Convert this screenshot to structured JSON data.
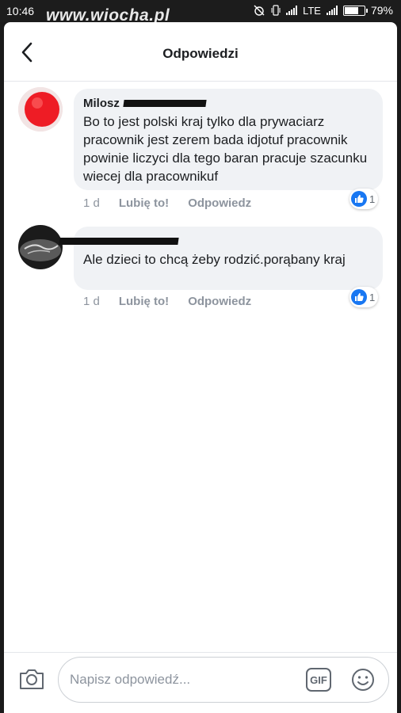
{
  "status_bar": {
    "time": "10:46",
    "watermark": "www.wiocha.pl",
    "network": "LTE",
    "battery": "79%",
    "battery_level": 0.79
  },
  "header": {
    "title": "Odpowiedzi",
    "back_icon": "chevron-left-icon"
  },
  "comments": [
    {
      "author": "Milosz",
      "text": "Bo to jest polski kraj tylko dla prywaciarz pracownik jest zerem bada idjotuf pracownik powinie liczyci dla tego baran pracuje szacunku wiecej dla pracownikuf",
      "time": "1 d",
      "like_label": "Lubię to!",
      "reply_label": "Odpowiedz",
      "reactions": "1"
    },
    {
      "author": "",
      "text": "Ale dzieci to chcą żeby rodzić.porąbany kraj",
      "time": "1 d",
      "like_label": "Lubię to!",
      "reply_label": "Odpowiedz",
      "reactions": "1"
    }
  ],
  "composer": {
    "placeholder": "Napisz odpowiedź...",
    "gif_label": "GIF",
    "camera_icon": "camera-icon",
    "emoji_icon": "smiley-icon"
  },
  "colors": {
    "like_blue": "#1877f2",
    "bubble_bg": "#f0f2f5",
    "muted_text": "#8d949e"
  }
}
